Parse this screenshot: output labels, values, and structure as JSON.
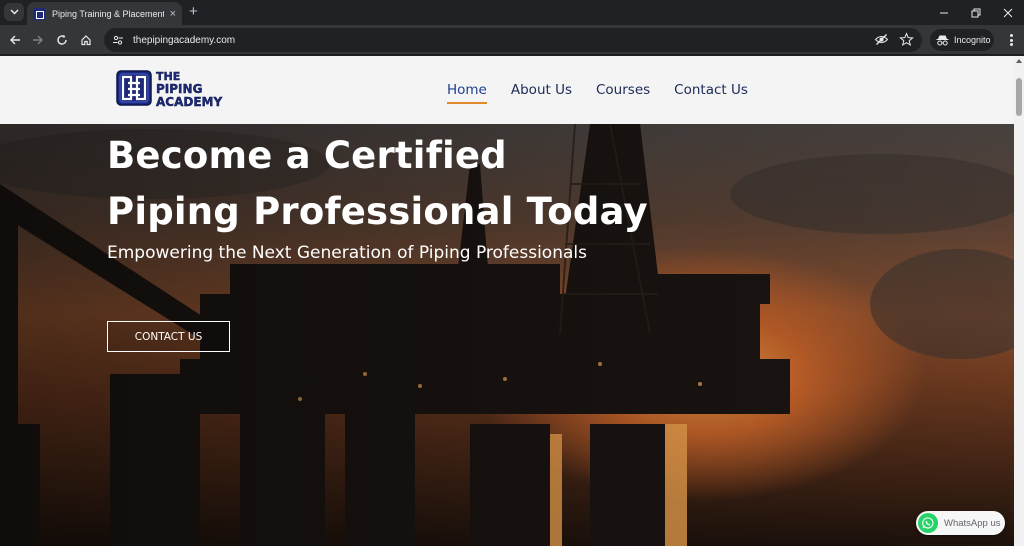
{
  "browser": {
    "tab_title": "Piping Training & Placement – T",
    "url": "thepipingacademy.com",
    "incognito_label": "Incognito",
    "new_tab_symbol": "+",
    "tab_close_symbol": "×"
  },
  "site": {
    "logo_lines": [
      "THE",
      "PIPING",
      "ACADEMY"
    ],
    "nav": [
      {
        "label": "Home",
        "active": true
      },
      {
        "label": "About Us"
      },
      {
        "label": "Courses"
      },
      {
        "label": "Contact Us"
      }
    ]
  },
  "hero": {
    "title_line1": "Become a Certified",
    "title_line2": "Piping Professional Today",
    "subtitle": "Empowering the Next Generation of Piping Professionals",
    "cta_label": "CONTACT US"
  },
  "whatsapp": {
    "label": "WhatsApp us"
  },
  "colors": {
    "brand_navy": "#1b2a57",
    "nav_underline": "#e08a2c",
    "whatsapp_green": "#25d366"
  }
}
